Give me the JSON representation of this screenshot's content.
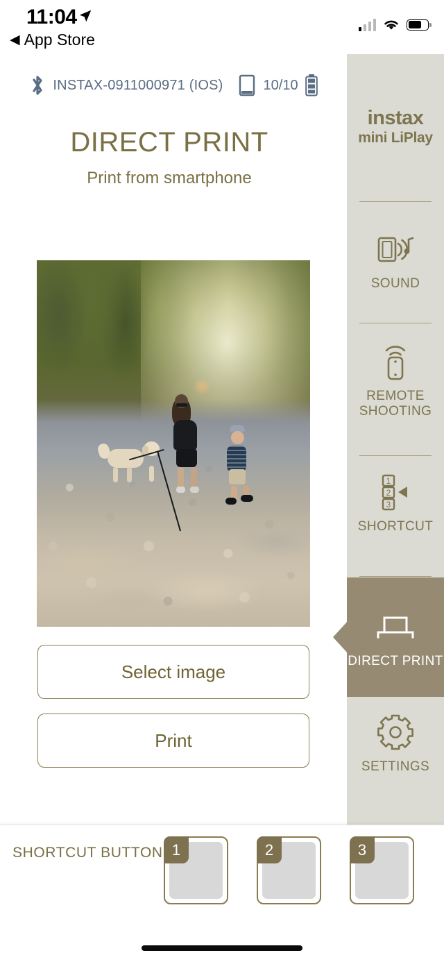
{
  "statusbar": {
    "time": "11:04",
    "back_label": "App Store",
    "back_arrow": "◀",
    "location_icon": "location-arrow-icon",
    "signal_icon": "cellular-signal-icon",
    "wifi_icon": "wifi-icon",
    "battery_icon": "battery-icon"
  },
  "device": {
    "bluetooth_icon": "bluetooth-icon",
    "name": "INSTAX-0911000971 (IOS)",
    "film_icon": "film-pack-icon",
    "film_count": "10/10",
    "battery_icon": "device-battery-icon"
  },
  "header": {
    "title": "DIRECT PRINT",
    "subtitle": "Print from smartphone"
  },
  "preview": {
    "alt": "photo-preview-forest-riverbed"
  },
  "actions": {
    "select_image": "Select image",
    "print": "Print"
  },
  "sidebar": {
    "logo_line1": "instax",
    "logo_line2": "mini LiPlay",
    "items": [
      {
        "label": "SOUND",
        "icon": "speaker-music-icon",
        "active": false
      },
      {
        "label": "REMOTE SHOOTING",
        "icon": "remote-wifi-icon",
        "active": false
      },
      {
        "label": "SHORTCUT",
        "icon": "numbered-list-icon",
        "active": false
      },
      {
        "label": "DIRECT PRINT",
        "icon": "printer-icon",
        "active": true
      },
      {
        "label": "SETTINGS",
        "icon": "gear-icon",
        "active": false
      }
    ]
  },
  "shortcut_bar": {
    "label": "SHORTCUT BUTTONS",
    "slots": [
      {
        "number": "1"
      },
      {
        "number": "2"
      },
      {
        "number": "3"
      }
    ]
  },
  "colors": {
    "accent_olive": "#7a7044",
    "accent_olive_dark": "#7d7150",
    "sidebar_bg": "#dbdbd3",
    "sidebar_active": "#968b72",
    "device_blue": "#5a6c84",
    "slot_gray": "#d8d8d8"
  }
}
